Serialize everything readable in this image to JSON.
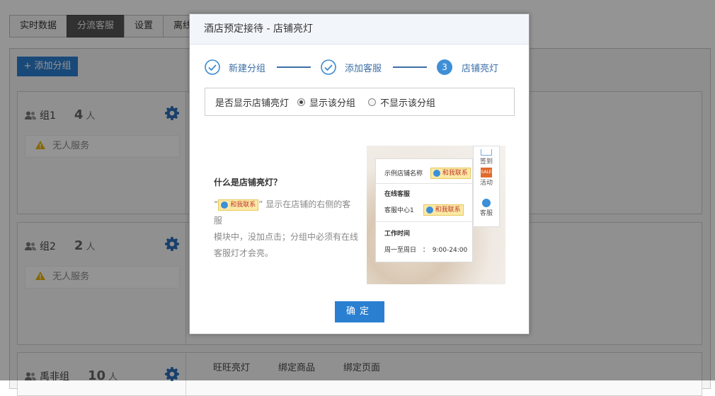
{
  "top_tabs": [
    "实时数据",
    "分流客服",
    "设置",
    "离线"
  ],
  "add_group_label": "+ 添加分组",
  "groups": [
    {
      "name": "组1",
      "count": "4",
      "unit": "人",
      "status": "无人服务"
    },
    {
      "name": "组2",
      "count": "2",
      "unit": "人",
      "status": "无人服务"
    },
    {
      "name": "禹非组",
      "count": "10",
      "unit": "人"
    }
  ],
  "group_sub_tabs": [
    "旺旺亮灯",
    "绑定商品",
    "绑定页面"
  ],
  "modal": {
    "title": "酒店预定接待 - 店铺亮灯",
    "steps": [
      {
        "label": "新建分组",
        "state": "done"
      },
      {
        "label": "添加客服",
        "state": "done"
      },
      {
        "number": "3",
        "label": "店铺亮灯",
        "state": "current"
      }
    ],
    "question": "是否显示店铺亮灯",
    "options": [
      {
        "label": "显示该分组",
        "selected": true
      },
      {
        "label": "不显示该分组",
        "selected": false
      }
    ],
    "explain_title": "什么是店铺亮灯？",
    "explain_quote_open": "“",
    "explain_quote_close": "”",
    "explain_badge": "和我联系",
    "explain_line1": " 显示在店铺的右侧的客服",
    "explain_line2": "模块中，没加点击；分组中必须有在线",
    "explain_line3": "客服灯才会亮。",
    "illustration": {
      "shop_name": "示例店铺名称",
      "badge": "和我联系",
      "online_title": "在线客服",
      "service_center": "客服中心1",
      "hours_title": "工作时间",
      "hours_days": "周一至周日",
      "hours_sep": "：",
      "hours_time": "9:00-24:00",
      "side_items": [
        "签到",
        "活动",
        "客服"
      ],
      "sale_text": "SALE"
    },
    "confirm_label": "确定"
  },
  "colors": {
    "accent": "#2b7fd0",
    "step": "#3b6fa6"
  }
}
